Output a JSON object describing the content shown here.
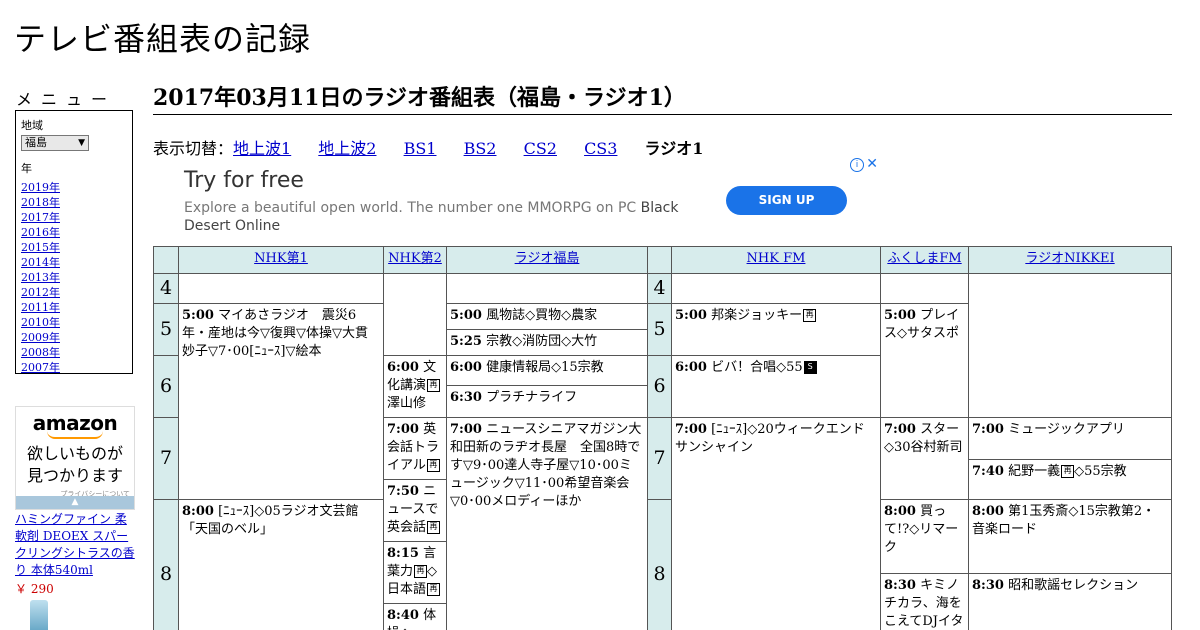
{
  "site_title": "テレビ番組表の記録",
  "sidebar": {
    "menu_label": "メニュー",
    "region_label": "地域",
    "region_selected": "福島",
    "year_label": "年",
    "years": [
      "2019年",
      "2018年",
      "2017年",
      "2016年",
      "2015年",
      "2014年",
      "2013年",
      "2012年",
      "2011年",
      "2010年",
      "2009年",
      "2008年",
      "2007年"
    ],
    "amazon": {
      "logo": "amazon",
      "copy_line1": "欲しいものが",
      "copy_line2": "見つかります",
      "privacy": "プライバシーについて",
      "product": "ハミングファイン 柔軟剤 DEOEX スパークリングシトラスの香り 本体540ml",
      "price": "￥ 290"
    }
  },
  "heading": "2017年03月11日のラジオ番組表（福島・ラジオ1）",
  "switcher": {
    "label": "表示切替：",
    "links": [
      "地上波1",
      "地上波2",
      "BS1",
      "BS2",
      "CS2",
      "CS3"
    ],
    "current": "ラジオ1"
  },
  "ad": {
    "title": "Try for free",
    "desc": "Explore a beautiful open world. The number one MMORPG on PC ",
    "brand": "Black Desert Online",
    "cta": "SIGN UP",
    "info": "i",
    "close": "✕"
  },
  "glyphs": {
    "re": "再",
    "st": "S"
  },
  "channels": [
    "NHK第1",
    "NHK第2",
    "ラジオ福島",
    "NHK FM",
    "ふくしまFM",
    "ラジオNIKKEI"
  ],
  "hours": [
    "4",
    "5",
    "6",
    "7",
    "8"
  ],
  "programs": {
    "nhk1_5": {
      "time": "5:00",
      "title": "マイあさラジオ　震災6年・産地は今▽復興▽体操▽大貫妙子▽7･00[ﾆｭｰｽ]▽絵本"
    },
    "nhk1_8": {
      "time": "8:00",
      "title": "[ﾆｭｰｽ]◇05ラジオ文芸館「天国のベル」"
    },
    "nhk2_6": {
      "time": "6:00",
      "title": "文化講演",
      "after": "澤山修"
    },
    "nhk2_7a": {
      "time": "7:00",
      "title": "英会話トライアル"
    },
    "nhk2_7b": {
      "time": "7:50",
      "title": "ニュースで英会話"
    },
    "nhk2_8a": {
      "time": "8:15",
      "title": "言葉力",
      "after": "◇日本語"
    },
    "nhk2_8b": {
      "time": "8:40",
      "title": "体操◇"
    },
    "rf_5a": {
      "time": "5:00",
      "title": "風物誌◇買物◇農家"
    },
    "rf_5b": {
      "time": "5:25",
      "title": "宗教◇消防団◇大竹"
    },
    "rf_6a": {
      "time": "6:00",
      "title": "健康情報局◇15宗教"
    },
    "rf_6b": {
      "time": "6:30",
      "title": "プラチナライフ"
    },
    "rf_7": {
      "time": "7:00",
      "title": "ニュースシニアマガジン大和田新のラヂオ長屋　全国8時です▽9･00達人寺子屋▽10･00ミュージック▽11･00希望音楽会▽0･00メロディーほか"
    },
    "fm_5": {
      "time": "5:00",
      "title": "邦楽ジョッキー"
    },
    "fm_6": {
      "time": "6:00",
      "title": "ビバ！合唱◇55"
    },
    "fm_7": {
      "time": "7:00",
      "title": "[ﾆｭｰｽ]◇20ウィークエンドサンシャイン"
    },
    "ffm_5": {
      "time": "5:00",
      "title": "プレイス◇サタスポ"
    },
    "ffm_7": {
      "time": "7:00",
      "title": "スター◇30谷村新司"
    },
    "ffm_8a": {
      "time": "8:00",
      "title": "買って!?◇リマーク"
    },
    "ffm_8b": {
      "time": "8:30",
      "title": "キミノチカラ、海をこえてDJイタル"
    },
    "nk_7a": {
      "time": "7:00",
      "title": "ミュージックアプリ"
    },
    "nk_7b": {
      "time": "7:40",
      "title": "紀野一義",
      "after": "◇55宗教"
    },
    "nk_8a": {
      "time": "8:00",
      "title": "第1玉秀斎◇15宗教第2・音楽ロード"
    },
    "nk_8b": {
      "time": "8:30",
      "title": "昭和歌謡セレクション"
    }
  }
}
